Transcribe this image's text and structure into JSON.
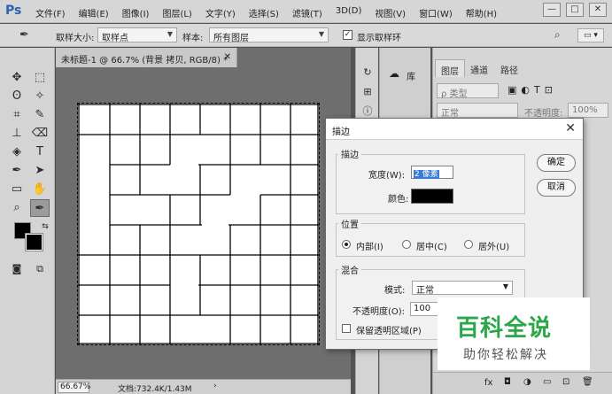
{
  "app": {
    "logo": "Ps"
  },
  "menu": [
    "文件(F)",
    "编辑(E)",
    "图像(I)",
    "图层(L)",
    "文字(Y)",
    "选择(S)",
    "滤镜(T)",
    "3D(D)",
    "视图(V)",
    "窗口(W)",
    "帮助(H)"
  ],
  "window_controls": {
    "minimize": "—",
    "restore": "□",
    "close": "✕"
  },
  "options": {
    "sample_size_label": "取样大小:",
    "sample_size_value": "取样点",
    "sample_label": "样本:",
    "sample_value": "所有图层",
    "show_ring_label": "显示取样环",
    "show_ring_checked": true
  },
  "document": {
    "tab_title": "未标题-1 @ 66.7% (背景 拷贝, RGB/8) *",
    "zoom": "66.67%",
    "info": "文档:732.4K/1.43M"
  },
  "panels": {
    "library_label": "库",
    "tabs": [
      "图层",
      "通道",
      "路径"
    ],
    "filter_kind": "ρ 类型",
    "blend_mode": "正常",
    "opacity_label": "不透明度:",
    "opacity_value": "100%"
  },
  "dialog": {
    "title": "描边",
    "stroke_group": "描边",
    "width_label": "宽度(W):",
    "width_value": "2 像素",
    "color_label": "颜色:",
    "stroke_color": "#000000",
    "position_group": "位置",
    "positions": [
      {
        "label": "内部(I)",
        "selected": true
      },
      {
        "label": "居中(C)",
        "selected": false
      },
      {
        "label": "居外(U)",
        "selected": false
      }
    ],
    "blend_group": "混合",
    "mode_label": "模式:",
    "mode_value": "正常",
    "opacity_label": "不透明度(O):",
    "opacity_value": "100",
    "preserve_label": "保留透明区域(P)",
    "ok_label": "确定",
    "cancel_label": "取消"
  },
  "watermark": {
    "main": "百科全说",
    "sub": "助你轻松解决"
  }
}
